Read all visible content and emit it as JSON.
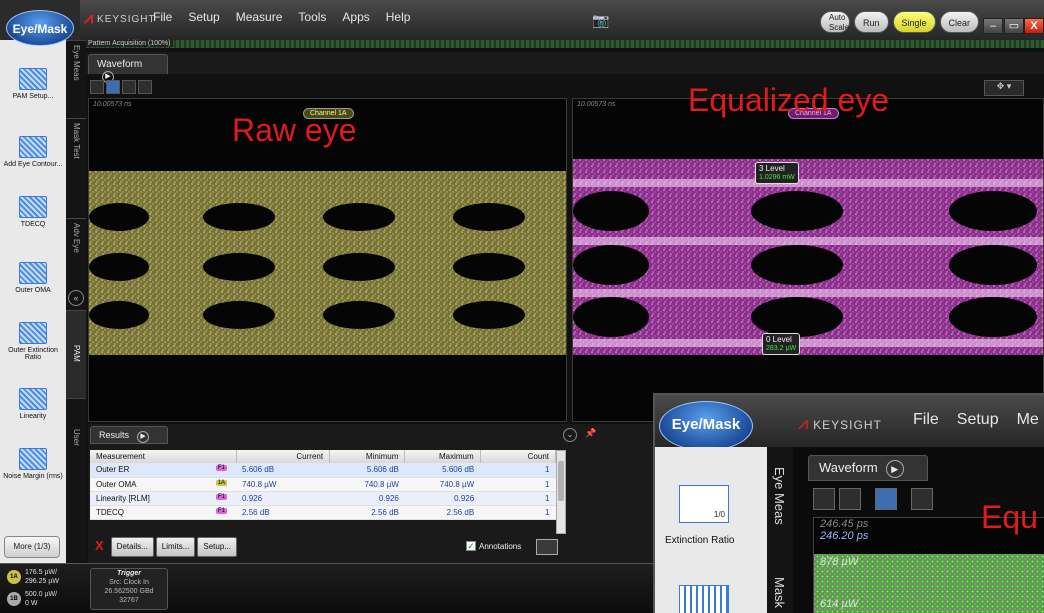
{
  "app": {
    "name": "Eye/Mask",
    "brand": "KEYSIGHT",
    "menu": [
      "File",
      "Setup",
      "Measure",
      "Tools",
      "Apps",
      "Help"
    ],
    "top_buttons": {
      "auto_scale": "Auto Scale",
      "run": "Run",
      "single": "Single",
      "clear": "Clear"
    },
    "window_controls": {
      "minimize": "–",
      "restore": "▭",
      "close": "X"
    },
    "acquisition": "Pattern Acquisition (100%)"
  },
  "left_panel": {
    "items": [
      {
        "label": "PAM Setup..."
      },
      {
        "label": "Add Eye Contour..."
      },
      {
        "label": "TDECQ"
      },
      {
        "label": "Outer OMA"
      },
      {
        "label": "Outer Extinction Ratio"
      },
      {
        "label": "Linearity"
      },
      {
        "label": "Noise Margin (rms)"
      }
    ],
    "more_label": "More (1/3)"
  },
  "vertical_tabs": [
    "Eye Meas",
    "Mask Test",
    "Adv Eye",
    "PAM",
    "User"
  ],
  "waveform": {
    "tab_label": "Waveform",
    "pane1": {
      "timestamp": "10.00573 ns",
      "channel_label": "Channel 1A",
      "overlay_title": "Raw eye"
    },
    "pane2": {
      "timestamp": "10.00573 ns",
      "channel_label": "Channel 1A",
      "overlay_title": "Equalized eye",
      "level3": {
        "label": "3 Level",
        "value": "1.0296 mW"
      },
      "level0": {
        "label": "0 Level",
        "value": "283.2 µW"
      }
    }
  },
  "results": {
    "tab_label": "Results",
    "columns": [
      "Measurement",
      "Current",
      "Minimum",
      "Maximum",
      "Count"
    ],
    "rows": [
      {
        "name": "Outer ER",
        "src": "F1",
        "current": "5.606 dB",
        "minimum": "5.606 dB",
        "maximum": "5.606 dB",
        "count": "1"
      },
      {
        "name": "Outer OMA",
        "src": "1A",
        "current": "740.8 µW",
        "minimum": "740.8 µW",
        "maximum": "740.8 µW",
        "count": "1"
      },
      {
        "name": "Linearity [RLM]",
        "src": "F1",
        "current": "0.926",
        "minimum": "0.926",
        "maximum": "0.926",
        "count": "1"
      },
      {
        "name": "TDECQ",
        "src": "F1",
        "current": "2.56 dB",
        "minimum": "2.56 dB",
        "maximum": "2.56 dB",
        "count": "1"
      }
    ],
    "buttons": {
      "delete": "X",
      "details": "Details...",
      "limits": "Limits...",
      "setup": "Setup..."
    },
    "annotations_label": "Annotations"
  },
  "status": {
    "ch1": {
      "badge": "1A",
      "line1": "176.5 µW/",
      "line2": "296.25 µW"
    },
    "ch2": {
      "badge": "1B",
      "line1": "500.0 µW/",
      "line2": "0 W"
    },
    "trigger": {
      "title": "Trigger",
      "src": "Src: Clock In",
      "rate": "26.562500 GBd",
      "pattern": "32767"
    }
  },
  "zoom_inset": {
    "app_name": "Eye/Mask",
    "brand": "KEYSIGHT",
    "menu": [
      "File",
      "Setup",
      "Me"
    ],
    "tab_eye_meas": "Eye Meas",
    "tab_mask": "Mask",
    "icon_caption": "Extinction Ratio",
    "icon_text": "1/0",
    "waveform_label": "Waveform",
    "ts1": "246.45 ps",
    "ts2": "246.20 ps",
    "val1": "878 µW",
    "val2": "614 µW",
    "overlay_fragment": "Equ"
  },
  "colors": {
    "raw_eye": "#d8d36a",
    "eq_eye": "#e064e0",
    "accent_red": "#e11b1b"
  }
}
